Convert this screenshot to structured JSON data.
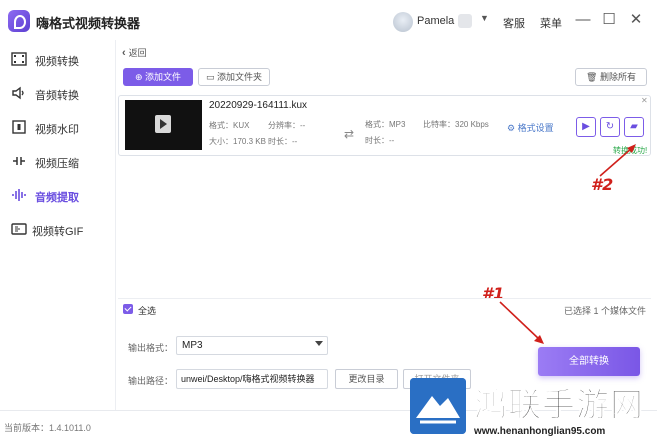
{
  "app": {
    "title": "嗨格式视频转换器",
    "user_name": "Pamela",
    "links": {
      "service": "客服",
      "menu": "菜单"
    },
    "window_controls": {
      "minimize": "—",
      "maximize": "☐",
      "close": "✕"
    },
    "version": "当前版本：1.4.1011.0"
  },
  "sidebar": {
    "items": [
      {
        "label": "视频转换",
        "icon": "film-strip-icon",
        "active": false
      },
      {
        "label": "音频转换",
        "icon": "speaker-icon",
        "active": false
      },
      {
        "label": "视频水印",
        "icon": "watermark-icon",
        "active": false
      },
      {
        "label": "视频压缩",
        "icon": "compress-icon",
        "active": false
      },
      {
        "label": "音频提取",
        "icon": "waveform-icon",
        "active": true
      },
      {
        "label": "视频转GIF",
        "icon": "gif-icon",
        "active": false
      }
    ]
  },
  "toolbar": {
    "back": "返回",
    "add_file": "添加文件",
    "add_folder": "添加文件夹",
    "clear_all": "删除所有"
  },
  "file": {
    "name": "20220929-164111.kux",
    "src_format": "格式：KUX",
    "resolution": "分辨率：--",
    "size": "大小：170.3 KB",
    "duration": "时长：--",
    "out_format": "格式：MP3",
    "bitrate": "比特率：320 Kbps",
    "out_duration": "时长：--",
    "format_settings": "格式设置",
    "status": "转换成功!"
  },
  "annotations": {
    "first": "#1",
    "second": "#2"
  },
  "bottom": {
    "select_all": "全选",
    "selected_count": "已选择 1 个媒体文件",
    "output_format_label": "输出格式：",
    "output_format": "MP3",
    "output_path_label": "输出路径：",
    "output_path": "unwei/Desktop/嗨格式视频转换器",
    "change_dir": "更改目录",
    "open_dir": "打开文件夹",
    "convert_all": "全部转换"
  },
  "watermark": {
    "title": "鸿联手游网",
    "url": "www.henanhonglian95.com"
  },
  "colors": {
    "accent": "#7c5ce8",
    "annotation": "#d0201b",
    "success": "#2aa84a"
  }
}
